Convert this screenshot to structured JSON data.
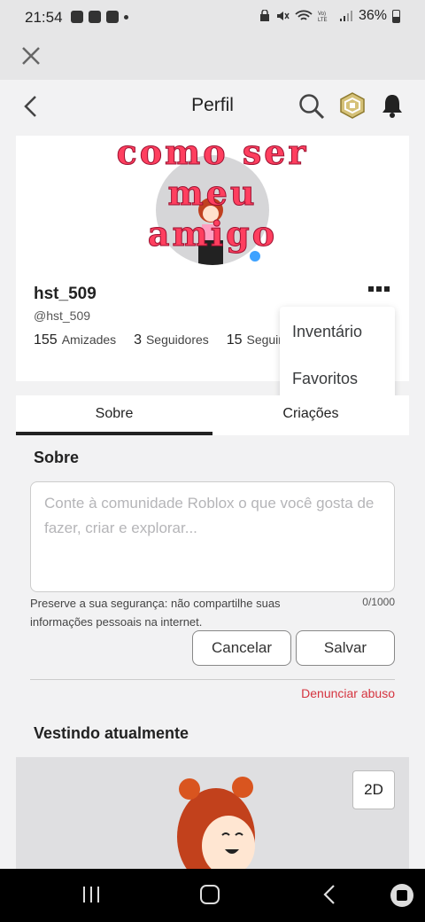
{
  "status_bar": {
    "time": "21:54",
    "battery": "36%"
  },
  "header": {
    "title": "Perfil"
  },
  "profile": {
    "overlay_lines": [
      "como ser",
      "meu",
      "amigo"
    ],
    "display_name": "hst_509",
    "handle": "@hst_509",
    "stats": [
      {
        "count": "155",
        "label": "Amizades"
      },
      {
        "count": "3",
        "label": "Seguidores"
      },
      {
        "count": "15",
        "label": "Seguindo"
      }
    ]
  },
  "dropdown": {
    "items": [
      "Inventário",
      "Favoritos"
    ]
  },
  "tabs": [
    "Sobre",
    "Criações"
  ],
  "about": {
    "title": "Sobre",
    "placeholder": "Conte à comunidade Roblox o que você gosta de fazer, criar e explorar...",
    "privacy_note": "Preserve a sua segurança: não compartilhe suas informações pessoais na internet.",
    "counter": "0/1000",
    "cancel_label": "Cancelar",
    "save_label": "Salvar",
    "report_label": "Denunciar abuso"
  },
  "wearing": {
    "title": "Vestindo atualmente",
    "view_toggle": "2D"
  }
}
